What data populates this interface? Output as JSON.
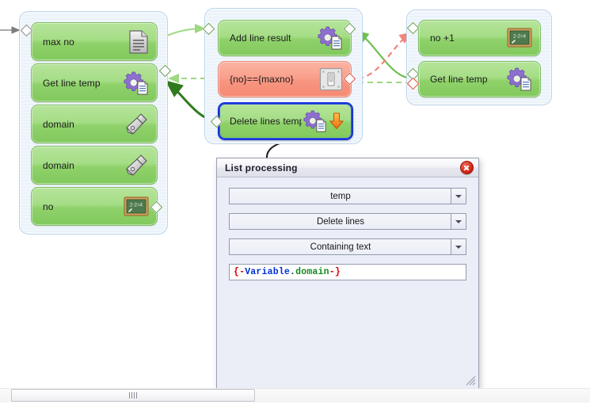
{
  "window": {
    "background_color": "#ffffff"
  },
  "flow": {
    "groups": [
      {
        "id": "group-left",
        "nodes": [
          {
            "label": "max no",
            "icon": "document-icon",
            "type": "action",
            "selected": false
          },
          {
            "label": "Get line temp",
            "icon": "gear-document-icon",
            "type": "action",
            "selected": false
          },
          {
            "label": "domain",
            "icon": "pen-nib-icon",
            "type": "action",
            "selected": false
          },
          {
            "label": "domain",
            "icon": "pen-nib-icon",
            "type": "action",
            "selected": false
          },
          {
            "label": "no",
            "icon": "blackboard-icon",
            "type": "action",
            "selected": false
          }
        ]
      },
      {
        "id": "group-middle",
        "nodes": [
          {
            "label": "Add line result",
            "icon": "gear-document-icon",
            "type": "action",
            "selected": false
          },
          {
            "label": "{no}=={maxno}",
            "icon": "switch-icon",
            "type": "condition",
            "selected": false
          },
          {
            "label": "Delete lines temp",
            "icon": "gear-document-icon",
            "type": "action",
            "selected": true,
            "badge": "orange-down-arrow-icon"
          }
        ]
      },
      {
        "id": "group-right",
        "nodes": [
          {
            "label": "no +1",
            "icon": "blackboard-icon",
            "type": "action",
            "selected": false
          },
          {
            "label": "Get line temp",
            "icon": "gear-document-icon",
            "type": "action",
            "selected": false
          }
        ]
      }
    ],
    "colors": {
      "node_green": "#8fd16a",
      "node_red": "#f79580",
      "selection_blue": "#1433d6",
      "wire_green": "#79c95a",
      "wire_dark_green": "#2f7a1f",
      "wire_red": "#f2857a",
      "group_border": "#b9d3ea"
    }
  },
  "dialog": {
    "title": "List processing",
    "close_label": "close-icon",
    "fields": [
      {
        "name": "list-select",
        "value": "temp",
        "control": "dropdown"
      },
      {
        "name": "operation-select",
        "value": "Delete lines",
        "control": "dropdown"
      },
      {
        "name": "criteria-select",
        "value": "Containing text",
        "control": "dropdown"
      }
    ],
    "expression": {
      "name": "expression-input",
      "value": "{-Variable.domain-}",
      "tokens": [
        {
          "text": "{-",
          "color": "#d60000"
        },
        {
          "text": "Variable",
          "color": "#0030d8"
        },
        {
          "text": ".",
          "color": "#303030"
        },
        {
          "text": "domain",
          "color": "#0f8c1e"
        },
        {
          "text": "-}",
          "color": "#d60000"
        }
      ]
    },
    "resize_grip": "resize-grip-icon"
  },
  "statusbar": {
    "scrollbar": {
      "name": "horizontal-scrollbar",
      "thumb_grip": "grip-lines-icon"
    }
  }
}
